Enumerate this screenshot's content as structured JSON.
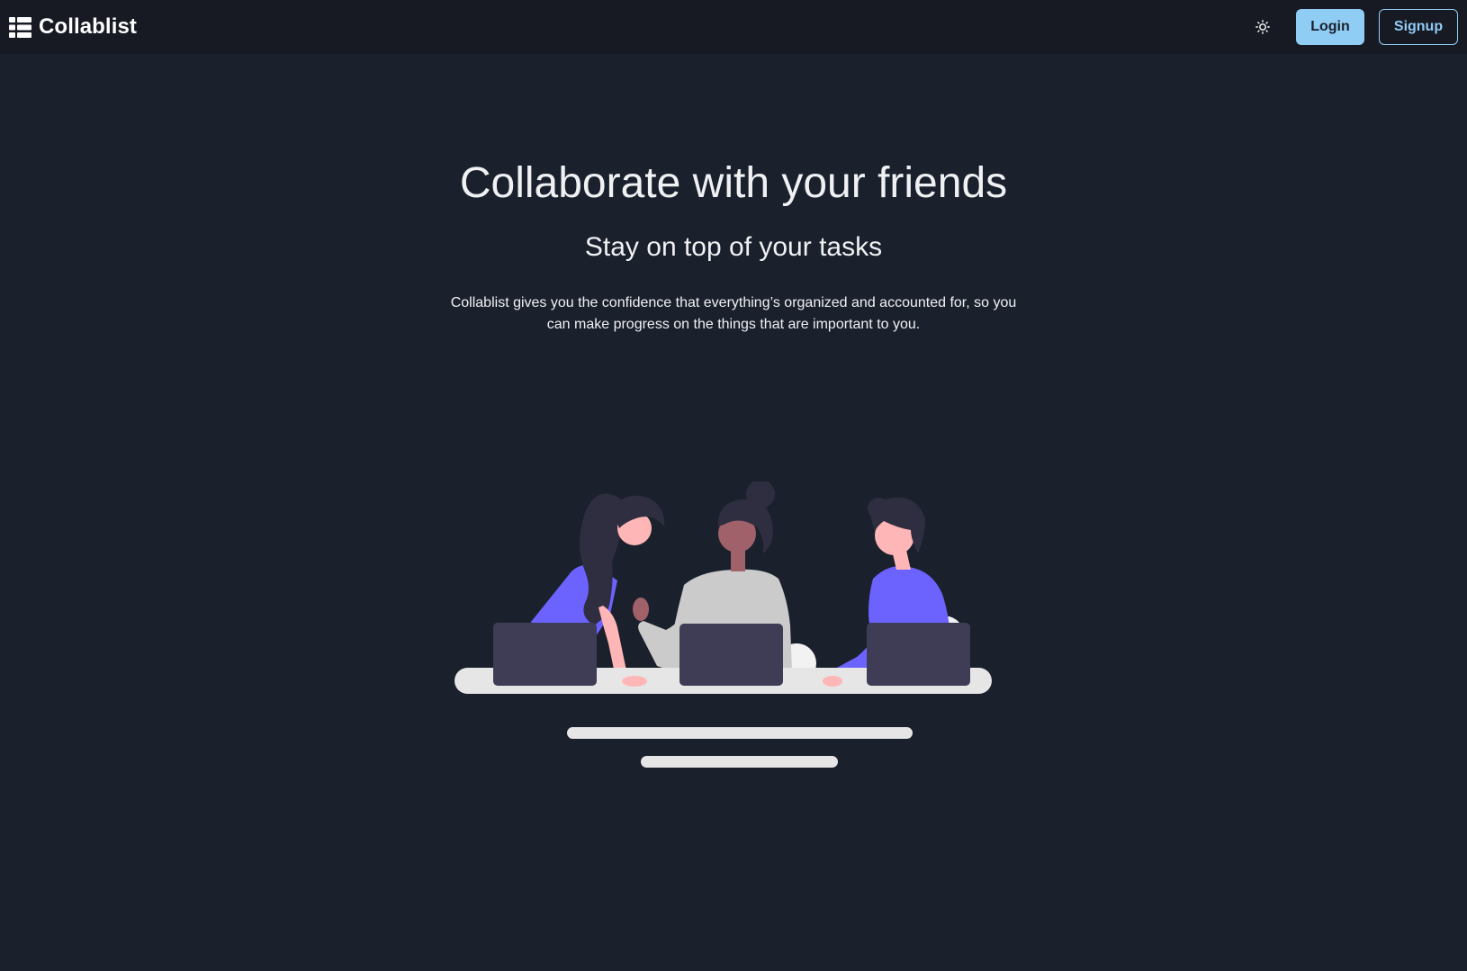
{
  "navbar": {
    "brand_name": "Collablist",
    "brand_icon": "list-icon",
    "theme_toggle_icon": "sun-icon",
    "login_label": "Login",
    "signup_label": "Signup"
  },
  "hero": {
    "title": "Collaborate with your friends",
    "subtitle": "Stay on top of your tasks",
    "description": "Collablist gives you the confidence that everything’s organized and accounted for, so you can make progress on the things that are important to you."
  },
  "illustration": {
    "name": "people-collaborating-illustration"
  },
  "colors": {
    "background": "#1a202c",
    "navbar": "#171923",
    "accent": "#90cdf4",
    "illustration_purple": "#6c63ff",
    "laptop": "#3f3d56",
    "skin": "#ffb6b6",
    "hair": "#2f2e41"
  }
}
